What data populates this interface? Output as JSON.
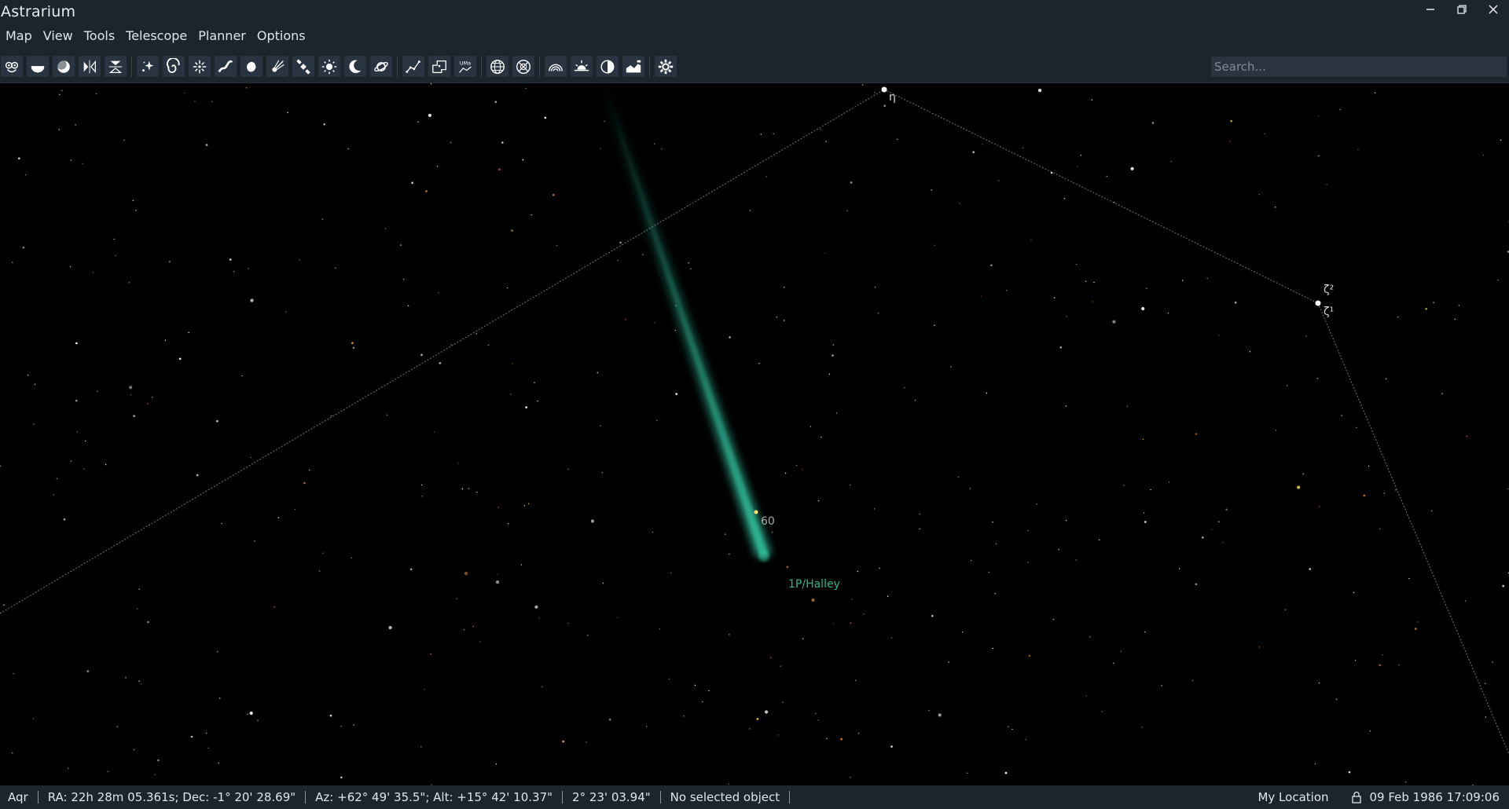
{
  "window": {
    "title": "Astrarium",
    "controls": [
      {
        "name": "minimize-icon"
      },
      {
        "name": "restore-icon"
      },
      {
        "name": "close-icon"
      }
    ]
  },
  "menu": [
    {
      "label": "Map"
    },
    {
      "label": "View"
    },
    {
      "label": "Tools"
    },
    {
      "label": "Telescope"
    },
    {
      "label": "Planner"
    },
    {
      "label": "Options"
    }
  ],
  "toolbar": {
    "groups": [
      [
        {
          "icon": "owl-icon",
          "name": "toolbar-owl-button"
        },
        {
          "icon": "horizon-ground-icon",
          "name": "toolbar-ground-button"
        },
        {
          "icon": "sphere-shade-icon",
          "name": "toolbar-atmosphere-button"
        },
        {
          "icon": "mirror-horizontal-icon",
          "name": "toolbar-flip-horizontal-button"
        },
        {
          "icon": "mirror-vertical-icon",
          "name": "toolbar-flip-vertical-button"
        }
      ],
      [
        {
          "icon": "stars-icon",
          "name": "toolbar-stars-button"
        },
        {
          "icon": "galaxy-icon",
          "name": "toolbar-deep-sky-button"
        },
        {
          "icon": "star-burst-icon",
          "name": "toolbar-novae-button"
        },
        {
          "icon": "milky-way-icon",
          "name": "toolbar-milky-way-button"
        },
        {
          "icon": "asteroid-icon",
          "name": "toolbar-asteroids-button"
        },
        {
          "icon": "comet-icon",
          "name": "toolbar-comets-button"
        },
        {
          "icon": "satellite-icon",
          "name": "toolbar-satellites-button"
        },
        {
          "icon": "sun-icon",
          "name": "toolbar-sun-button"
        },
        {
          "icon": "moon-icon",
          "name": "toolbar-moon-button"
        },
        {
          "icon": "planet-icon",
          "name": "toolbar-planets-button"
        }
      ],
      [
        {
          "icon": "constellation-lines-icon",
          "name": "toolbar-constellation-lines-button"
        },
        {
          "icon": "constellation-borders-icon",
          "name": "toolbar-constellation-borders-button"
        },
        {
          "icon": "constellation-labels-icon",
          "name": "toolbar-constellation-labels-button"
        }
      ],
      [
        {
          "icon": "globe-grid-icon",
          "name": "toolbar-equatorial-grid-button"
        },
        {
          "icon": "horizontal-grid-icon",
          "name": "toolbar-horizontal-grid-button"
        }
      ],
      [
        {
          "icon": "rainbow-arc-icon",
          "name": "toolbar-atmosphere-glow-button"
        },
        {
          "icon": "sunrise-icon",
          "name": "toolbar-daylight-button"
        },
        {
          "icon": "half-moon-disk-icon",
          "name": "toolbar-night-mode-button"
        },
        {
          "icon": "landscape-icon",
          "name": "toolbar-landscape-button"
        }
      ],
      [
        {
          "icon": "gear-icon",
          "name": "toolbar-settings-button"
        }
      ]
    ],
    "search_placeholder": "Search..."
  },
  "sky": {
    "labels": {
      "eta": "η",
      "zeta2": "ζ²",
      "zeta1": "ζ¹",
      "star_60": "60",
      "comet": "1P/Halley"
    },
    "colors": {
      "background": "#000000",
      "comet": "#2fb394",
      "constellation_line": "#8c8c8c",
      "star_white": "#ffffff",
      "star_orange": "#e8903a",
      "star_yellow": "#ffd84a"
    }
  },
  "statusbar": {
    "constellation": "Aqr",
    "equatorial": "RA: 22h 28m 05.361s; Dec: -1° 20' 28.69\"",
    "horizontal": "Az: +62° 49' 35.5\"; Alt: +15° 42' 10.37\"",
    "fov": "2° 23' 03.94\"",
    "selection": "No selected object",
    "location": "My Location",
    "datetime": "09 Feb 1986 17:09:06"
  }
}
